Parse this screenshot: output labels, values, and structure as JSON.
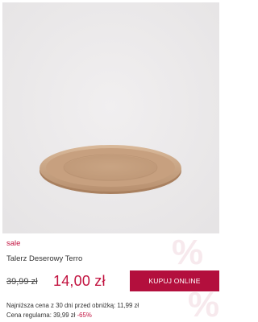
{
  "product": {
    "image_alt": "Talerz Deserowy Terro",
    "badge": "sale",
    "name": "Talerz Deserowy Terro",
    "old_price": "39,99 zł",
    "new_price": "14,00 zł",
    "buy_label": "KUPUJ ONLINE",
    "lowest_price_label": "Najniższa cena z 30 dni przed obniżką: ",
    "lowest_price_value": "11,99 zł",
    "regular_price_label": "Cena regularna: ",
    "regular_price_value": "39,99 zł",
    "discount": "-65%"
  },
  "colors": {
    "accent": "#c2123f",
    "button": "#b30f3d",
    "photo_background": "#eceaeb",
    "plate": "#c8a282"
  }
}
